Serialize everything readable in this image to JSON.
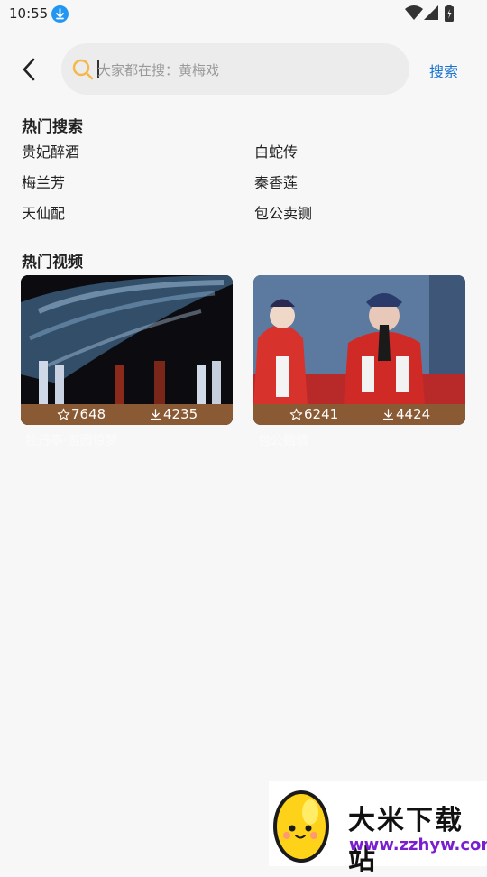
{
  "status_bar": {
    "time": "10:55"
  },
  "search": {
    "placeholder": "大家都在搜：黄梅戏",
    "button_label": "搜索"
  },
  "hot_search": {
    "title": "热门搜索",
    "items": [
      "贵妃醉酒",
      "白蛇传",
      "梅兰芳",
      "秦香莲",
      "天仙配",
      "包公卖铡"
    ]
  },
  "hot_videos": {
    "title": "热门视频",
    "items": [
      {
        "likes": "7648",
        "downloads": "4235",
        "title": "牡丹亭·游园惊梦"
      },
      {
        "likes": "6241",
        "downloads": "4424",
        "title": "包公赔情"
      }
    ]
  },
  "watermark": {
    "brand": "大米下载站",
    "url": "www.zzhyw.com"
  }
}
